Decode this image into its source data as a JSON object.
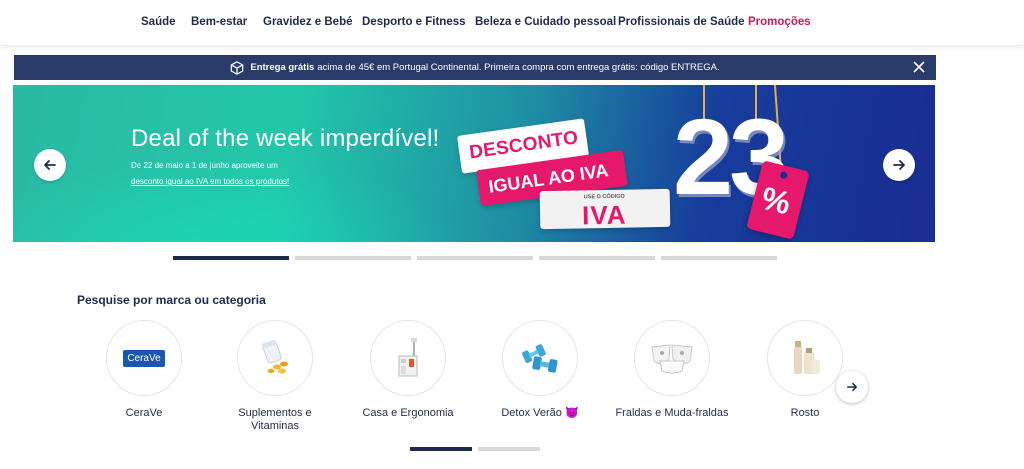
{
  "nav": {
    "items": [
      {
        "label": "Saúde"
      },
      {
        "label": "Bem-estar"
      },
      {
        "label": "Gravidez e Bebé"
      },
      {
        "label": "Desporto e Fitness"
      },
      {
        "label": "Beleza e Cuidado pessoal"
      },
      {
        "label": "Profissionais de Saúde"
      },
      {
        "label": "Promoções"
      }
    ]
  },
  "notice": {
    "bold": "Entrega grátis",
    "text": "acima de 45€ em Portugal Continental. Primeira compra com entrega grátis: código ENTREGA."
  },
  "hero": {
    "title": "Deal of the week imperdível!",
    "line1": "De 22 de maio a 1 de junho aproveite um",
    "line2": "desconto igual ao IVA em todos os produtos!",
    "tag1": "DESCONTO",
    "tag2": "IGUAL AO IVA",
    "code_hint": "USE O CÓDIGO",
    "code": "IVA",
    "number": "23",
    "percent": "%"
  },
  "slider": {
    "slide_count": 5,
    "active_index": 0
  },
  "categories": {
    "title": "Pesquise por marca ou categoria",
    "items": [
      {
        "label": "CeraVe",
        "logo_text": "CeraVe"
      },
      {
        "label": "Suplementos e Vitaminas"
      },
      {
        "label": "Casa e Ergonomia"
      },
      {
        "label": "Detox Verão 😈"
      },
      {
        "label": "Fraldas e Muda-fraldas"
      },
      {
        "label": "Rosto"
      }
    ],
    "page_count": 2,
    "active_page": 0
  },
  "colors": {
    "navy": "#1e2a4a",
    "promo_pink": "#d4145a",
    "tag_pink": "#e5186c",
    "notice_bg": "#2a3a6b"
  }
}
